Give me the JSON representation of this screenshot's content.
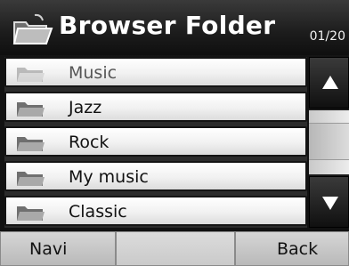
{
  "header": {
    "title": "Browser Folder",
    "page_counter": "01/20",
    "icon": "open-folder-icon"
  },
  "folder_list": {
    "items": [
      {
        "label": "Music",
        "state": "dimmed",
        "icon": "folder-icon"
      },
      {
        "label": "Jazz",
        "state": "normal",
        "icon": "folder-icon"
      },
      {
        "label": "Rock",
        "state": "normal",
        "icon": "folder-icon"
      },
      {
        "label": "My music",
        "state": "normal",
        "icon": "folder-icon"
      },
      {
        "label": "Classic",
        "state": "normal",
        "icon": "folder-icon"
      }
    ]
  },
  "scrollbar": {
    "up_icon": "arrow-up-icon",
    "down_icon": "arrow-down-icon"
  },
  "bottom_bar": {
    "navi_label": "Navi",
    "blank_label": "",
    "back_label": "Back"
  },
  "colors": {
    "header_bg": "#1c1c1c",
    "item_bg": "#f1f1f1",
    "bottom_button_bg": "#c8c8c8",
    "text_dark": "#111111",
    "text_light": "#ffffff"
  }
}
